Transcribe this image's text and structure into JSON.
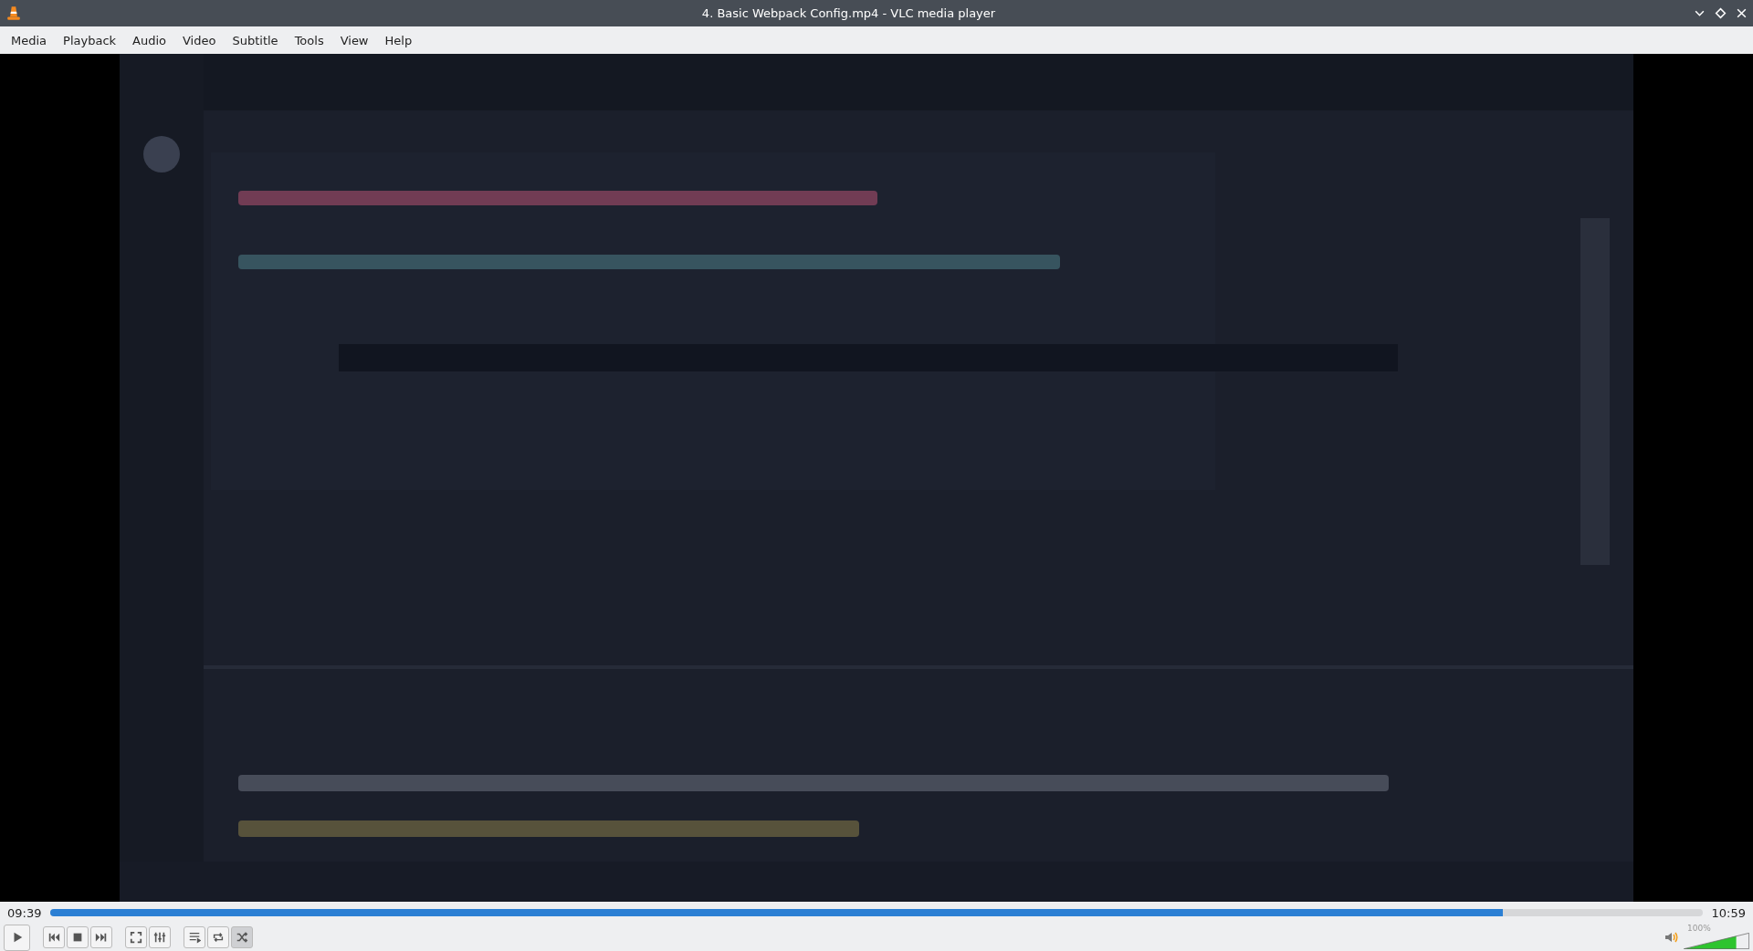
{
  "window": {
    "title": "4. Basic Webpack Config.mp4 - VLC media player"
  },
  "menu": [
    "Media",
    "Playback",
    "Audio",
    "Video",
    "Subtitle",
    "Tools",
    "View",
    "Help"
  ],
  "seek": {
    "elapsed": "09:39",
    "total": "10:59",
    "level": 0.879
  },
  "controls": [
    {
      "buttons": [
        {
          "kind": "play",
          "on": false
        }
      ]
    },
    {
      "buttons": [
        {
          "kind": "previous",
          "on": false
        },
        {
          "kind": "stop",
          "on": false
        },
        {
          "kind": "next",
          "on": false
        }
      ]
    },
    {
      "buttons": [
        {
          "kind": "fullscreen",
          "on": false
        },
        {
          "kind": "extended",
          "on": false
        }
      ]
    },
    {
      "buttons": [
        {
          "kind": "playlist",
          "on": false
        },
        {
          "kind": "loop",
          "on": false
        },
        {
          "kind": "shuffle",
          "on": true
        }
      ]
    }
  ],
  "volume": {
    "level": 0.8,
    "reading": "100%"
  }
}
